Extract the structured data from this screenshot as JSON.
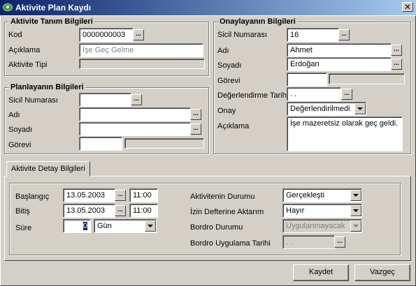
{
  "window": {
    "title": "Aktivite Plan Kaydı",
    "close_glyph": "✕"
  },
  "aktivite_tanim": {
    "legend": "Aktivite Tanım Bilgileri",
    "kod_label": "Kod",
    "kod_value": "0000000003",
    "aciklama_label": "Açıklama",
    "aciklama_value": "İşe Geç Gelme",
    "tipi_label": "Aktivite Tipi",
    "tipi_value": ""
  },
  "planlayan": {
    "legend": "Planlayanın Bilgileri",
    "sicil_label": "Sicil Numarası",
    "sicil_value": "",
    "adi_label": "Adı",
    "adi_value": "",
    "soyadi_label": "Soyadı",
    "soyadi_value": "",
    "gorevi_label": "Görevi",
    "gorevi_value": ""
  },
  "onaylayan": {
    "legend": "Onaylayanın Bilgileri",
    "sicil_label": "Sicil Numarası",
    "sicil_value": "16",
    "adi_label": "Adı",
    "adi_value": "Ahmet",
    "soyadi_label": "Soyadı",
    "soyadi_value": "Erdoğan",
    "gorevi_label": "Görevi",
    "gorevi_value": "",
    "degerlendirme_label": "Değerlendirme Tarihi",
    "degerlendirme_value": " .  .",
    "onay_label": "Onay",
    "onay_value": "Değerlendirilmedi",
    "aciklama_label": "Açıklama",
    "aciklama_value": "İşe mazeretsiz olarak geç geldi."
  },
  "detay": {
    "tab_label": "Aktivite Detay Bilgileri",
    "baslangic_label": "Başlangıç",
    "baslangic_date": "13.05.2003",
    "baslangic_time": "11:00",
    "bitis_label": "Bitiş",
    "bitis_date": "13.05.2003",
    "bitis_time": "11:00",
    "sure_label": "Süre",
    "sure_value": "0",
    "sure_unit": "Gün",
    "durum_label": "Aktivitenin Durumu",
    "durum_value": "Gerçekleşti",
    "izin_label": "İzin Defterine Aktarım",
    "izin_value": "Hayır",
    "bordro_label": "Bordro Durumu",
    "bordro_value": "Uygulanmayacak",
    "bordro_tarih_label": "Bordro Uygulama Tarihi",
    "bordro_tarih_value": " .  ."
  },
  "buttons": {
    "kaydet": "Kaydet",
    "vazgec": "Vazgeç"
  },
  "icons": {
    "ellipsis": "...",
    "window_icon": "app-eye-icon"
  },
  "colors": {
    "titlebar_start": "#0a246a",
    "titlebar_end": "#a6caf0",
    "face": "#d4d0c8"
  }
}
